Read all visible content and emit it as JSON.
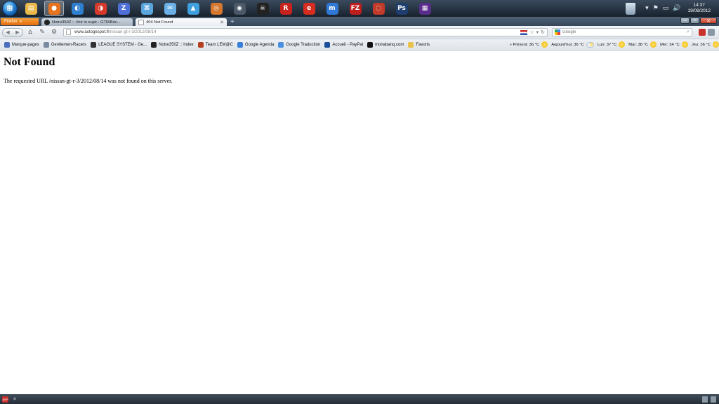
{
  "taskbar": {
    "start_glyph": "⊞",
    "apps": [
      {
        "name": "windows-explorer",
        "glyph": "▤",
        "color": "#e8b84a",
        "active": false
      },
      {
        "name": "firefox",
        "glyph": "●",
        "color": "#e8731e",
        "active": true
      },
      {
        "name": "app-blue-swirl",
        "glyph": "◐",
        "color": "#2f7fd1",
        "active": false
      },
      {
        "name": "app-red-swirl",
        "glyph": "◑",
        "color": "#d63a2a",
        "active": false
      },
      {
        "name": "app-z",
        "glyph": "Z",
        "color": "#4f6fd8",
        "active": false
      },
      {
        "name": "app-network",
        "glyph": "⌘",
        "color": "#5aa7e0",
        "active": false
      },
      {
        "name": "app-mail",
        "glyph": "✉",
        "color": "#6ab0e6",
        "active": false
      },
      {
        "name": "app-bird",
        "glyph": "▲",
        "color": "#3fa0e0",
        "active": false
      },
      {
        "name": "app-browser",
        "glyph": "◎",
        "color": "#d5772e",
        "active": false
      },
      {
        "name": "app-steam",
        "glyph": "◉",
        "color": "#4a5868",
        "active": false
      },
      {
        "name": "app-dark",
        "glyph": "☠",
        "color": "#222222",
        "active": false
      },
      {
        "name": "app-r-racing",
        "glyph": "R",
        "color": "#c8221c",
        "active": false
      },
      {
        "name": "app-e-racing",
        "glyph": "e",
        "color": "#d62d20",
        "active": false
      },
      {
        "name": "app-m",
        "glyph": "m",
        "color": "#2f78d6",
        "active": false
      },
      {
        "name": "filezilla",
        "glyph": "FZ",
        "color": "#bf1e1e",
        "active": false
      },
      {
        "name": "app-red-ring",
        "glyph": "◌",
        "color": "#c23a2a",
        "active": false
      },
      {
        "name": "photoshop",
        "glyph": "Ps",
        "color": "#1d3e6e",
        "active": false
      },
      {
        "name": "color-pick",
        "glyph": "▦",
        "color": "#5a2d8c",
        "active": false
      }
    ],
    "tray_glyphs": [
      "▾",
      "⚑",
      "▭",
      "🔊"
    ],
    "time": "14:37",
    "date": "19/08/2012"
  },
  "browser": {
    "menu_label": "Firefox",
    "tabs": [
      {
        "title": "Notre350Z :: Voir le sujet - GTR/Bric...",
        "active": false
      },
      {
        "title": "404 Not Found",
        "active": true
      }
    ],
    "new_tab": "+",
    "window_controls": {
      "min": "–",
      "max": "▫",
      "close": "✕"
    }
  },
  "navbar": {
    "back": "◀",
    "forward": "▶",
    "home": "⌂",
    "tools": [
      "✎",
      "⚙"
    ],
    "url_host": "www.autogespot.fr",
    "url_path": "/nissan-gt-r-3/2012/08/14",
    "url_buttons": [
      "☆",
      "▾",
      "↻"
    ],
    "search_placeholder": "Google",
    "search_go": "⌕"
  },
  "bookmarks": {
    "items": [
      {
        "label": "Marque-pages",
        "color": "#4a6fbf"
      },
      {
        "label": "Gentlemen-Racers",
        "color": "#7a8aa0"
      },
      {
        "label": "LEAGUE SYSTEM - Ge...",
        "color": "#333333"
      },
      {
        "label": "Notre350Z :: Index",
        "color": "#222222"
      },
      {
        "label": "Team LEM@C",
        "color": "#b5401f"
      },
      {
        "label": "Google Agenda",
        "color": "#3a7fd6"
      },
      {
        "label": "Google Traduction",
        "color": "#4a8fe0"
      },
      {
        "label": "Accueil - PayPal",
        "color": "#1b4f9a"
      },
      {
        "label": "monabanq.com",
        "color": "#111111"
      },
      {
        "label": "Favoris",
        "color": "#e8c24a"
      }
    ],
    "weather": [
      {
        "label": "» Présent: 36 °C",
        "icon": "sun"
      },
      {
        "label": "Aujourd'hui: 36 °C",
        "icon": "cloud-sun"
      },
      {
        "label": "Lun: 37 °C",
        "icon": "sun"
      },
      {
        "label": "Mar: 38 °C",
        "icon": "sun"
      },
      {
        "label": "Mer: 34 °C",
        "icon": "sun"
      },
      {
        "label": "Jeu: 36 °C",
        "icon": "sun"
      }
    ]
  },
  "page": {
    "title": "Not Found",
    "message": "The requested URL /nissan-gt-r-3/2012/08/14 was not found on this server."
  },
  "statusbar": {
    "abp_label": "ABP",
    "close": "✕"
  }
}
